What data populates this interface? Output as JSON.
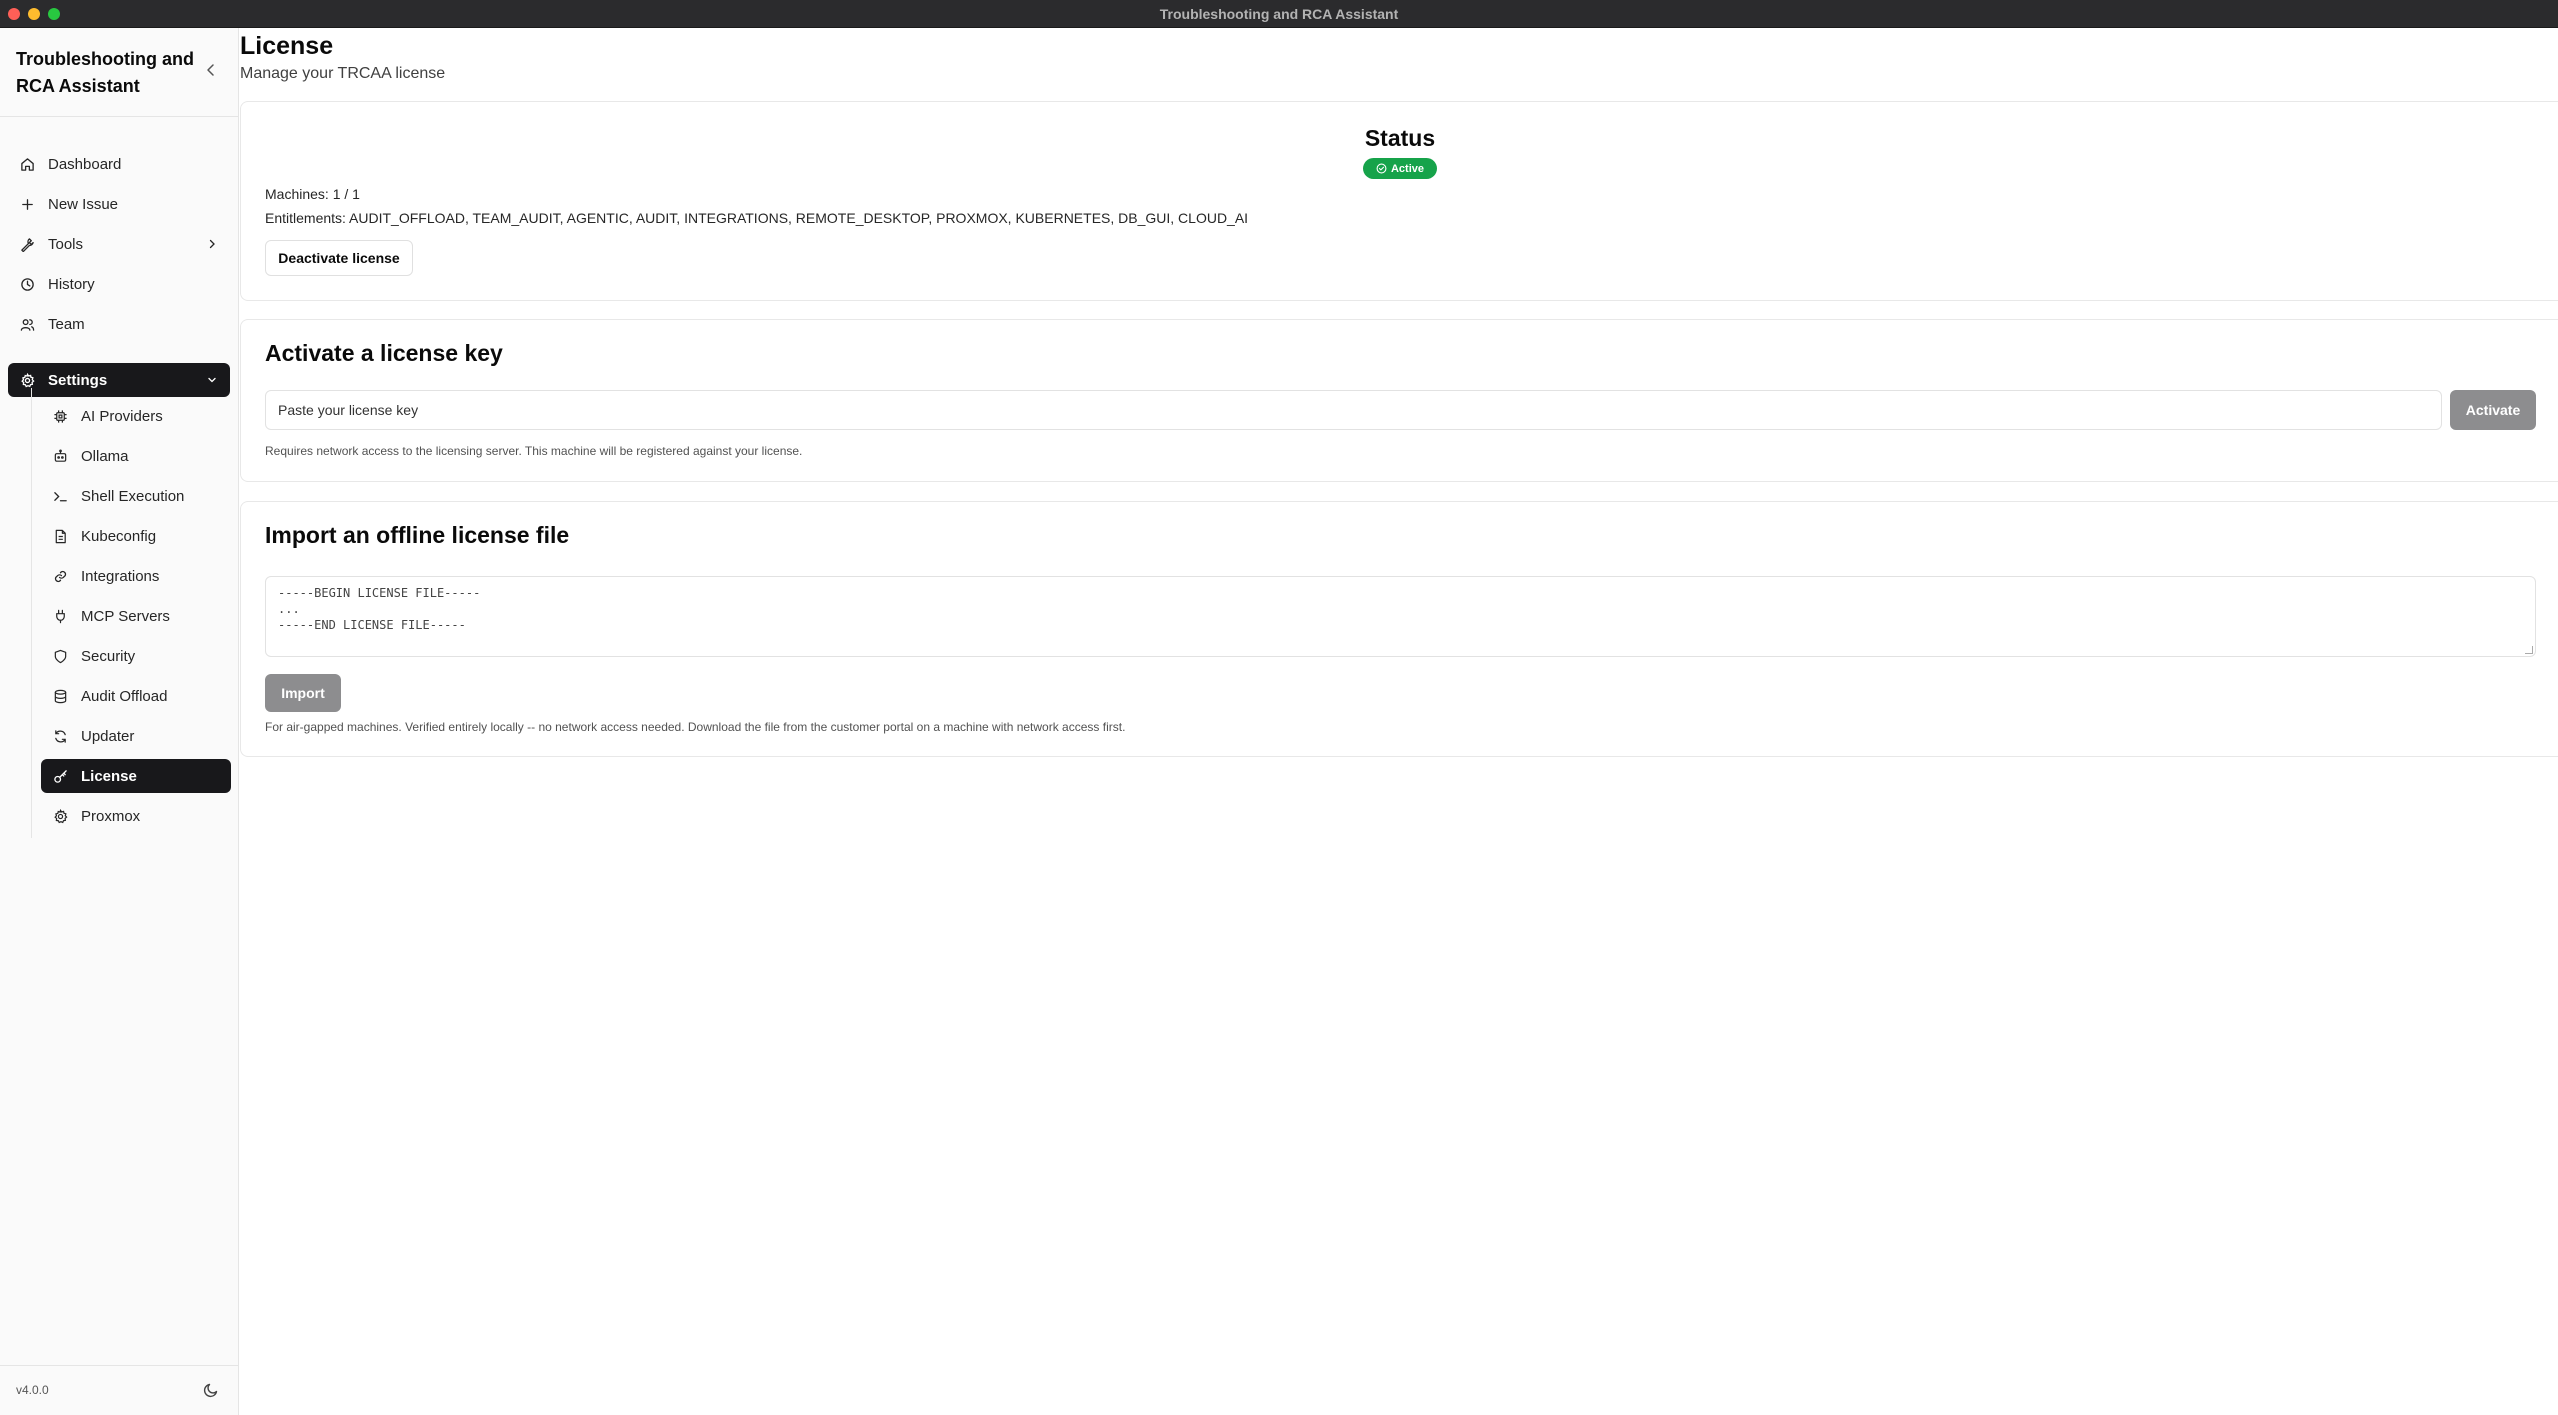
{
  "window": {
    "title": "Troubleshooting and RCA Assistant"
  },
  "sidebar": {
    "brand": "Troubleshooting and RCA Assistant",
    "nav": [
      {
        "label": "Dashboard",
        "icon": "home-icon"
      },
      {
        "label": "New Issue",
        "icon": "plus-icon"
      },
      {
        "label": "Tools",
        "icon": "wrench-icon"
      },
      {
        "label": "History",
        "icon": "clock-icon"
      },
      {
        "label": "Team",
        "icon": "users-icon"
      }
    ],
    "settings": {
      "label": "Settings",
      "items": [
        {
          "label": "AI Providers",
          "icon": "cpu-icon"
        },
        {
          "label": "Ollama",
          "icon": "bot-icon"
        },
        {
          "label": "Shell Execution",
          "icon": "terminal-icon"
        },
        {
          "label": "Kubeconfig",
          "icon": "file-icon"
        },
        {
          "label": "Integrations",
          "icon": "link-icon"
        },
        {
          "label": "MCP Servers",
          "icon": "plug-icon"
        },
        {
          "label": "Security",
          "icon": "shield-icon"
        },
        {
          "label": "Audit Offload",
          "icon": "database-icon"
        },
        {
          "label": "Updater",
          "icon": "refresh-icon"
        },
        {
          "label": "License",
          "icon": "key-icon",
          "active": true
        },
        {
          "label": "Proxmox",
          "icon": "gear-icon"
        }
      ]
    },
    "version": "v4.0.0"
  },
  "page": {
    "title": "License",
    "subtitle": "Manage your TRCAA license"
  },
  "status": {
    "title": "Status",
    "badge": "Active",
    "badge_color": "#16a34a",
    "machines": "Machines: 1 / 1",
    "entitlements": "Entitlements: AUDIT_OFFLOAD, TEAM_AUDIT, AGENTIC, AUDIT, INTEGRATIONS, REMOTE_DESKTOP, PROXMOX, KUBERNETES, DB_GUI, CLOUD_AI",
    "deactivate_label": "Deactivate license"
  },
  "activate": {
    "title": "Activate a license key",
    "placeholder": "Paste your license key",
    "button": "Activate",
    "help": "Requires network access to the licensing server. This machine will be registered against your license."
  },
  "offline": {
    "title": "Import an offline license file",
    "placeholder": "-----BEGIN LICENSE FILE-----\n...\n-----END LICENSE FILE-----",
    "button": "Import",
    "help": "For air-gapped machines. Verified entirely locally -- no network access needed. Download the file from the customer portal on a machine with network access first."
  }
}
